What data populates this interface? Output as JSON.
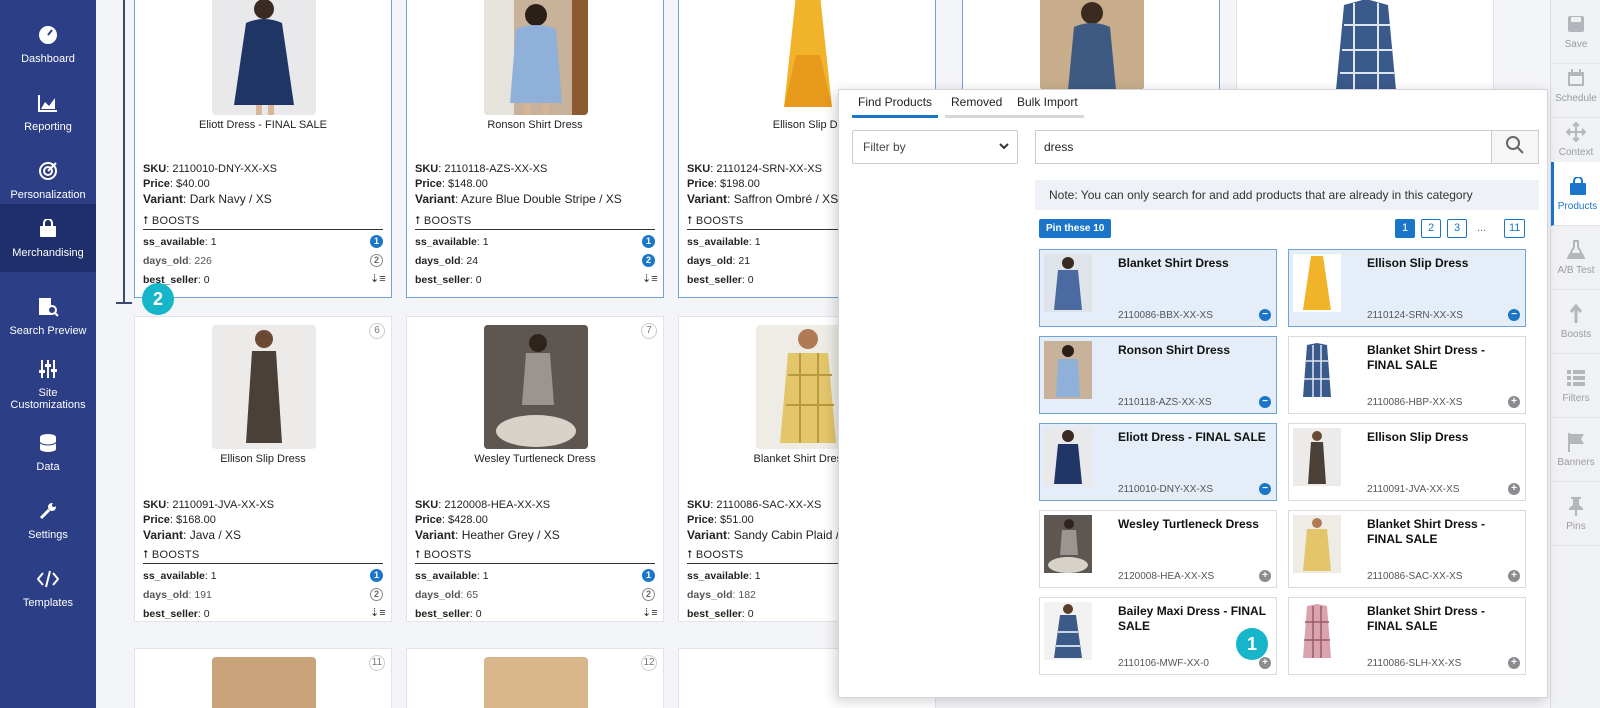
{
  "nav": [
    {
      "label": "Dashboard",
      "icon": "gauge-icon"
    },
    {
      "label": "Reporting",
      "icon": "chart-icon"
    },
    {
      "label": "Personalization",
      "icon": "target-icon"
    },
    {
      "label": "Merchandising",
      "icon": "bag-icon"
    },
    {
      "label": "Search Preview",
      "icon": "search-doc-icon"
    },
    {
      "label": "Site Customizations",
      "icon": "sliders-icon"
    },
    {
      "label": "Data",
      "icon": "database-icon"
    },
    {
      "label": "Settings",
      "icon": "wrench-icon"
    },
    {
      "label": "Templates",
      "icon": "code-icon"
    }
  ],
  "boosts_heading": "BOOSTS",
  "cards": [
    {
      "name": "Eliott Dress - FINAL SALE",
      "sku": "2110010-DNY-XX-XS",
      "price": "$40.00",
      "variant": "Dark Navy / XS",
      "ss_available": "1",
      "days_old": "226",
      "best_seller": "0",
      "ind1": "1",
      "ind2": "2"
    },
    {
      "name": "Ronson Shirt Dress",
      "sku": "2110118-AZS-XX-XS",
      "price": "$148.00",
      "variant": "Azure Blue Double Stripe / XS",
      "ss_available": "1",
      "days_old": "24",
      "best_seller": "0",
      "ind1": "1",
      "ind2": "2"
    },
    {
      "name": "Ellison Slip Dr",
      "sku": "2110124-SRN-XX-XS",
      "price": "$198.00",
      "variant": "Saffron Ombré / XS",
      "ss_available": "1",
      "days_old": "21",
      "best_seller": "0"
    },
    {
      "name": "Ellison Slip Dress",
      "sku": "2110091-JVA-XX-XS",
      "price": "$168.00",
      "variant": "Java / XS",
      "ss_available": "1",
      "days_old": "191",
      "best_seller": "0",
      "pos": "6",
      "ind1": "1",
      "ind2": "2"
    },
    {
      "name": "Wesley Turtleneck Dress",
      "sku": "2120008-HEA-XX-XS",
      "price": "$428.00",
      "variant": "Heather Grey / XS",
      "ss_available": "1",
      "days_old": "65",
      "best_seller": "0",
      "pos": "7",
      "ind1": "1",
      "ind2": "2"
    },
    {
      "name": "Blanket Shirt Dress - I",
      "sku": "2110086-SAC-XX-XS",
      "price": "$51.00",
      "variant": "Sandy Cabin Plaid /",
      "ss_available": "1",
      "days_old": "182",
      "best_seller": "0"
    }
  ],
  "row3_positions": [
    "11",
    "12"
  ],
  "labels": {
    "sku": "SKU",
    "price": "Price",
    "variant": "Variant",
    "ss_available": "ss_available",
    "days_old": "days_old",
    "best_seller": "best_seller"
  },
  "right_bar": [
    {
      "label": "Save",
      "icon": "save-icon"
    },
    {
      "label": "Schedule",
      "icon": "calendar-icon"
    },
    {
      "label": "Context",
      "icon": "move-icon"
    },
    {
      "label": "Products",
      "icon": "shopping-bag-icon"
    },
    {
      "label": "A/B Test",
      "icon": "flask-icon"
    },
    {
      "label": "Boosts",
      "icon": "arrow-up-icon"
    },
    {
      "label": "Filters",
      "icon": "list-icon"
    },
    {
      "label": "Banners",
      "icon": "flag-icon"
    },
    {
      "label": "Pins",
      "icon": "pin-icon"
    }
  ],
  "panel": {
    "tabs": [
      "Find Products",
      "Removed",
      "Bulk Import"
    ],
    "filter_placeholder": "Filter by",
    "search_value": "dress",
    "note": "Note: You can only search for and add products that are already in this category",
    "pin_button": "Pin these 10",
    "pages": [
      "1",
      "2",
      "3",
      "...",
      "11"
    ],
    "results": [
      {
        "name": "Blanket Shirt Dress",
        "sku": "2110086-BBX-XX-XS",
        "pinned": true
      },
      {
        "name": "Ellison Slip Dress",
        "sku": "2110124-SRN-XX-XS",
        "pinned": true
      },
      {
        "name": "Ronson Shirt Dress",
        "sku": "2110118-AZS-XX-XS",
        "pinned": true
      },
      {
        "name": "Blanket Shirt Dress - FINAL SALE",
        "sku": "2110086-HBP-XX-XS",
        "pinned": false
      },
      {
        "name": "Eliott Dress - FINAL SALE",
        "sku": "2110010-DNY-XX-XS",
        "pinned": true
      },
      {
        "name": "Ellison Slip Dress",
        "sku": "2110091-JVA-XX-XS",
        "pinned": false
      },
      {
        "name": "Wesley Turtleneck Dress",
        "sku": "2120008-HEA-XX-XS",
        "pinned": false
      },
      {
        "name": "Blanket Shirt Dress - FINAL SALE",
        "sku": "2110086-SAC-XX-XS",
        "pinned": false
      },
      {
        "name": "Bailey Maxi Dress - FINAL SALE",
        "sku": "2110106-MWF-XX-0",
        "pinned": false
      },
      {
        "name": "Blanket Shirt Dress - FINAL SALE",
        "sku": "2110086-SLH-XX-XS",
        "pinned": false
      }
    ]
  },
  "step_badges": [
    "1",
    "2"
  ],
  "colors": {
    "nav_bg": "#2c3e85",
    "accent": "#1b75c9",
    "step": "#16b5c9"
  }
}
